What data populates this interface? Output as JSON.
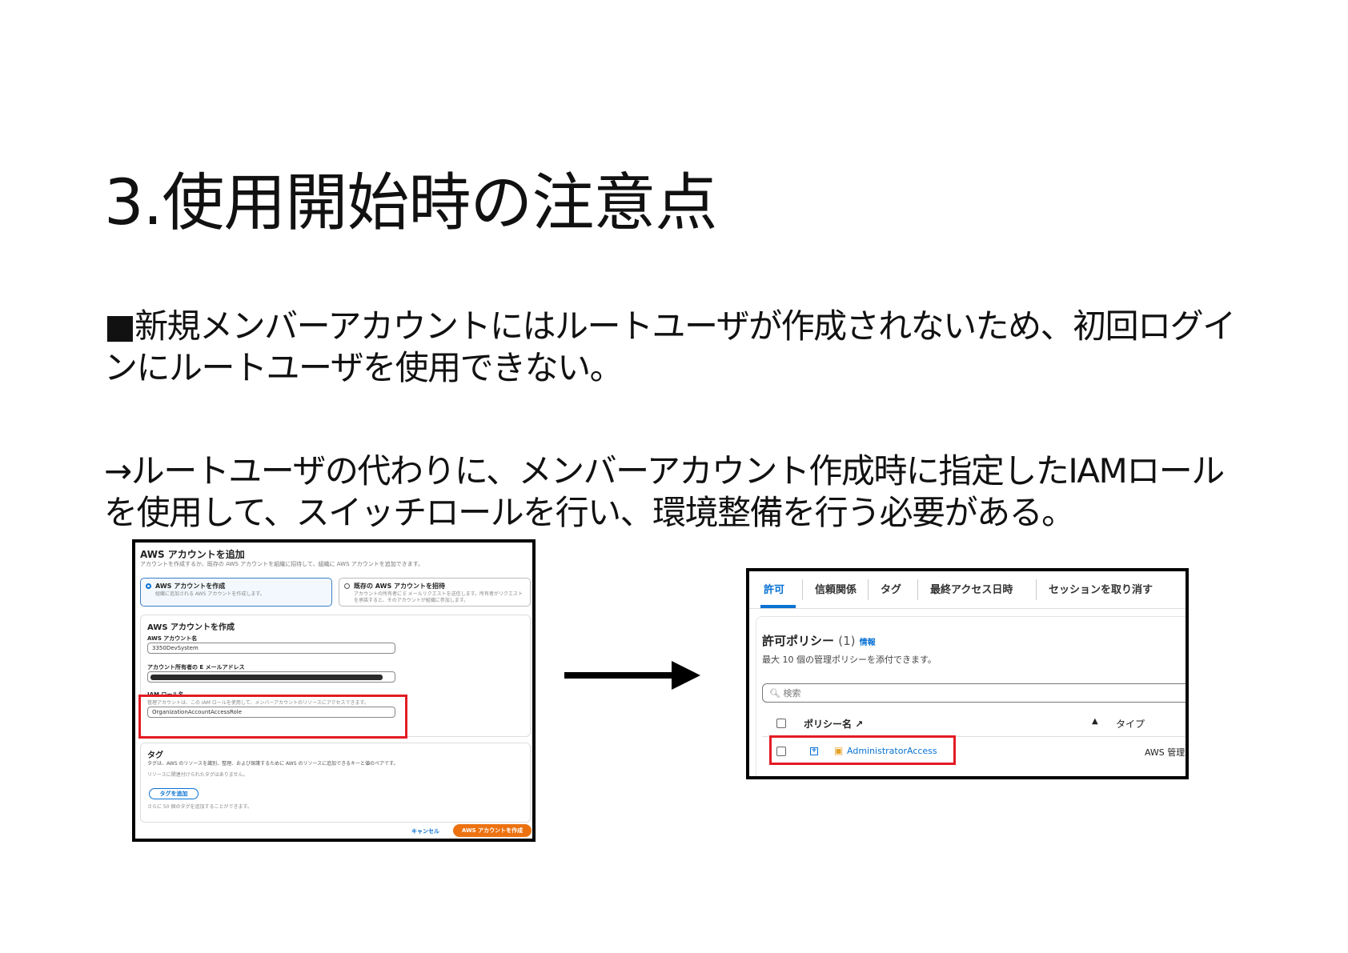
{
  "slide": {
    "title": "3.使用開始時の注意点",
    "para1": "■新規メンバーアカウントにはルートユーザが作成されないため、初回ログインにルートユーザを使用できない。",
    "para2": "→ルートユーザの代わりに、メンバーアカウント作成時に指定したIAMロールを使用して、スイッチロールを行い、環境整備を行う必要がある。"
  },
  "left_screenshot": {
    "title": "AWS アカウントを追加",
    "subtitle": "アカウントを作成するか、既存の AWS アカウントを組織に招待して、組織に AWS アカウントを追加できます。",
    "option_create": {
      "label": "AWS アカウントを作成",
      "desc": "組織に追加される AWS アカウントを作成します。"
    },
    "option_invite": {
      "label": "既存の AWS アカウントを招待",
      "desc": "アカウントの所有者に E メールリクエストを送信します。所有者がリクエストを承諾すると、そのアカウントが組織に参加します。"
    },
    "create_section": {
      "heading": "AWS アカウントを作成",
      "account_name_label": "AWS アカウント名",
      "account_name_value": "3350DevSystem",
      "email_label": "アカウント所有者の E メールアドレス",
      "iam_role_label": "IAM ロール名",
      "iam_role_desc": "管理アカウントは、この IAM ロールを使用して、メンバーアカウントのリソースにアクセスできます。",
      "iam_role_value": "OrganizationAccountAccessRole"
    },
    "tag_section": {
      "heading": "タグ",
      "desc": "タグは、AWS のリソースを識別、整理、および保護するために AWS のリソースに追加できるキーと値のペアです。",
      "empty": "リソースに関連付けられたタグはありません。",
      "add_button": "タグを追加",
      "limit": "さらに 50 個のタグを追加することができます。"
    },
    "cancel": "キャンセル",
    "create_button": "AWS アカウントを作成"
  },
  "right_screenshot": {
    "tabs": [
      "許可",
      "信頼関係",
      "タグ",
      "最終アクセス日時",
      "セッションを取り消す"
    ],
    "policy_heading": "許可ポリシー",
    "policy_count": "(1)",
    "info_link": "情報",
    "policy_desc": "最大 10 個の管理ポリシーを添付できます。",
    "search_placeholder": "検索",
    "col_policy_name": "ポリシー名",
    "sort_indicator": "▲",
    "col_type": "タイプ",
    "row_policy": "AdministratorAccess",
    "row_type": "AWS 管理"
  },
  "colors": {
    "highlight": "#e31b23",
    "aws_link": "#0972d3",
    "aws_orange": "#ec7211"
  }
}
